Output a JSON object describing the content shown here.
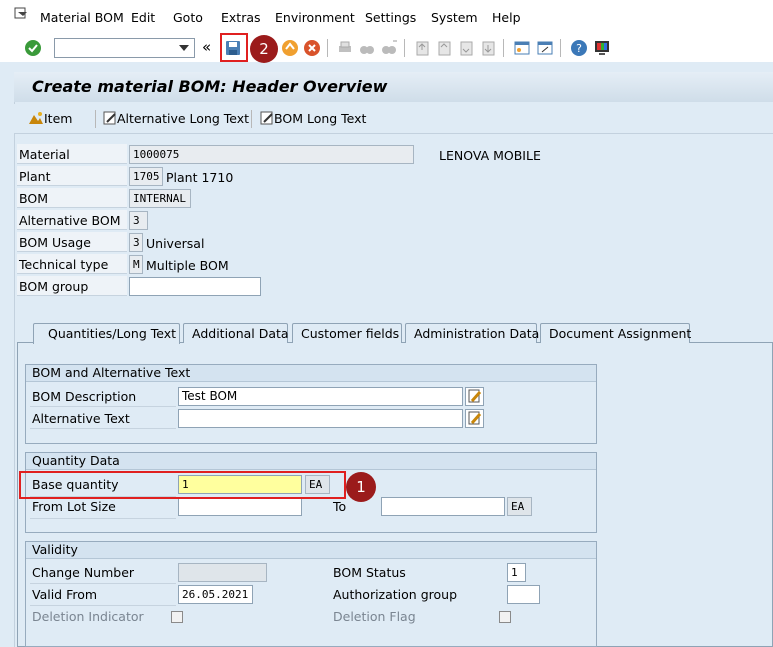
{
  "menu": {
    "items": [
      "Material BOM",
      "Edit",
      "Goto",
      "Extras",
      "Environment",
      "Settings",
      "System",
      "Help"
    ]
  },
  "toolbar": {
    "command_value": "",
    "nav_back_symbol": "«"
  },
  "header": {
    "title": "Create material BOM: Header Overview"
  },
  "app_toolbar": {
    "item_label": "Item",
    "alt_long_text_label": "Alternative Long Text",
    "bom_long_text_label": "BOM Long Text"
  },
  "fields": {
    "material_label": "Material",
    "material_value": "1000075",
    "material_desc": "LENOVA MOBILE",
    "plant_label": "Plant",
    "plant_value": "1705",
    "plant_desc": "Plant 1710",
    "bom_label": "BOM",
    "bom_value": "INTERNAL",
    "alt_bom_label": "Alternative BOM",
    "alt_bom_value": "3",
    "bom_usage_label": "BOM Usage",
    "bom_usage_value": "3",
    "bom_usage_desc": "Universal",
    "tech_type_label": "Technical type",
    "tech_type_value": "M",
    "tech_type_desc": "Multiple BOM",
    "bom_group_label": "BOM group",
    "bom_group_value": ""
  },
  "tabs": [
    {
      "label": "Quantities/Long Text",
      "active": true
    },
    {
      "label": "Additional Data",
      "active": false
    },
    {
      "label": "Customer fields",
      "active": false
    },
    {
      "label": "Administration Data",
      "active": false
    },
    {
      "label": "Document Assignment",
      "active": false
    }
  ],
  "bom_alt_text": {
    "title": "BOM and Alternative Text",
    "bom_desc_label": "BOM Description",
    "bom_desc_value": "Test BOM",
    "alt_text_label": "Alternative Text",
    "alt_text_value": ""
  },
  "quantity": {
    "title": "Quantity Data",
    "base_qty_label": "Base quantity",
    "base_qty_value": "1",
    "base_qty_unit": "EA",
    "from_lot_label": "From Lot Size",
    "from_lot_value": "",
    "to_label": "To",
    "to_value": "",
    "to_unit": "EA"
  },
  "validity": {
    "title": "Validity",
    "change_number_label": "Change Number",
    "change_number_value": "",
    "valid_from_label": "Valid From",
    "valid_from_value": "26.05.2021",
    "deletion_ind_label": "Deletion Indicator",
    "bom_status_label": "BOM Status",
    "bom_status_value": "1",
    "auth_group_label": "Authorization group",
    "auth_group_value": "",
    "deletion_flag_label": "Deletion Flag"
  },
  "annotations": {
    "step1": "1",
    "step2": "2"
  },
  "colors": {
    "highlight_red": "#e02020",
    "badge": "#9b1b1b",
    "focus_field": "#ffff9e"
  }
}
